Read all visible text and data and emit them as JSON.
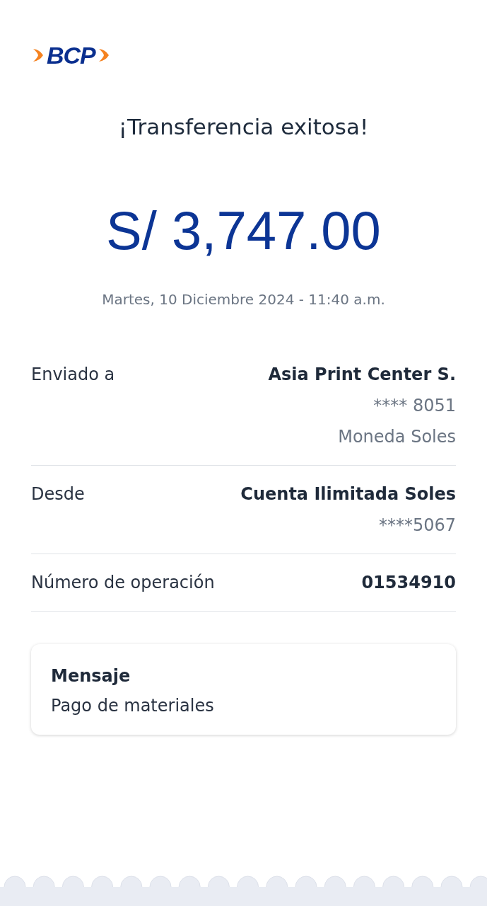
{
  "logo": {
    "text": "BCP"
  },
  "title": "¡Transferencia exitosa!",
  "amount": "S/ 3,747.00",
  "datetime": "Martes, 10 Diciembre 2024 - 11:40 a.m.",
  "details": [
    {
      "label": "Enviado a",
      "lines": [
        "Asia Print Center S.",
        "**** 8051",
        "Moneda Soles"
      ]
    },
    {
      "label": "Desde",
      "lines": [
        "Cuenta Ilimitada Soles",
        "****5067"
      ]
    },
    {
      "label": "Número de operación",
      "lines": [
        "01534910"
      ]
    }
  ],
  "message": {
    "title": "Mensaje",
    "text": "Pago de materiales"
  }
}
